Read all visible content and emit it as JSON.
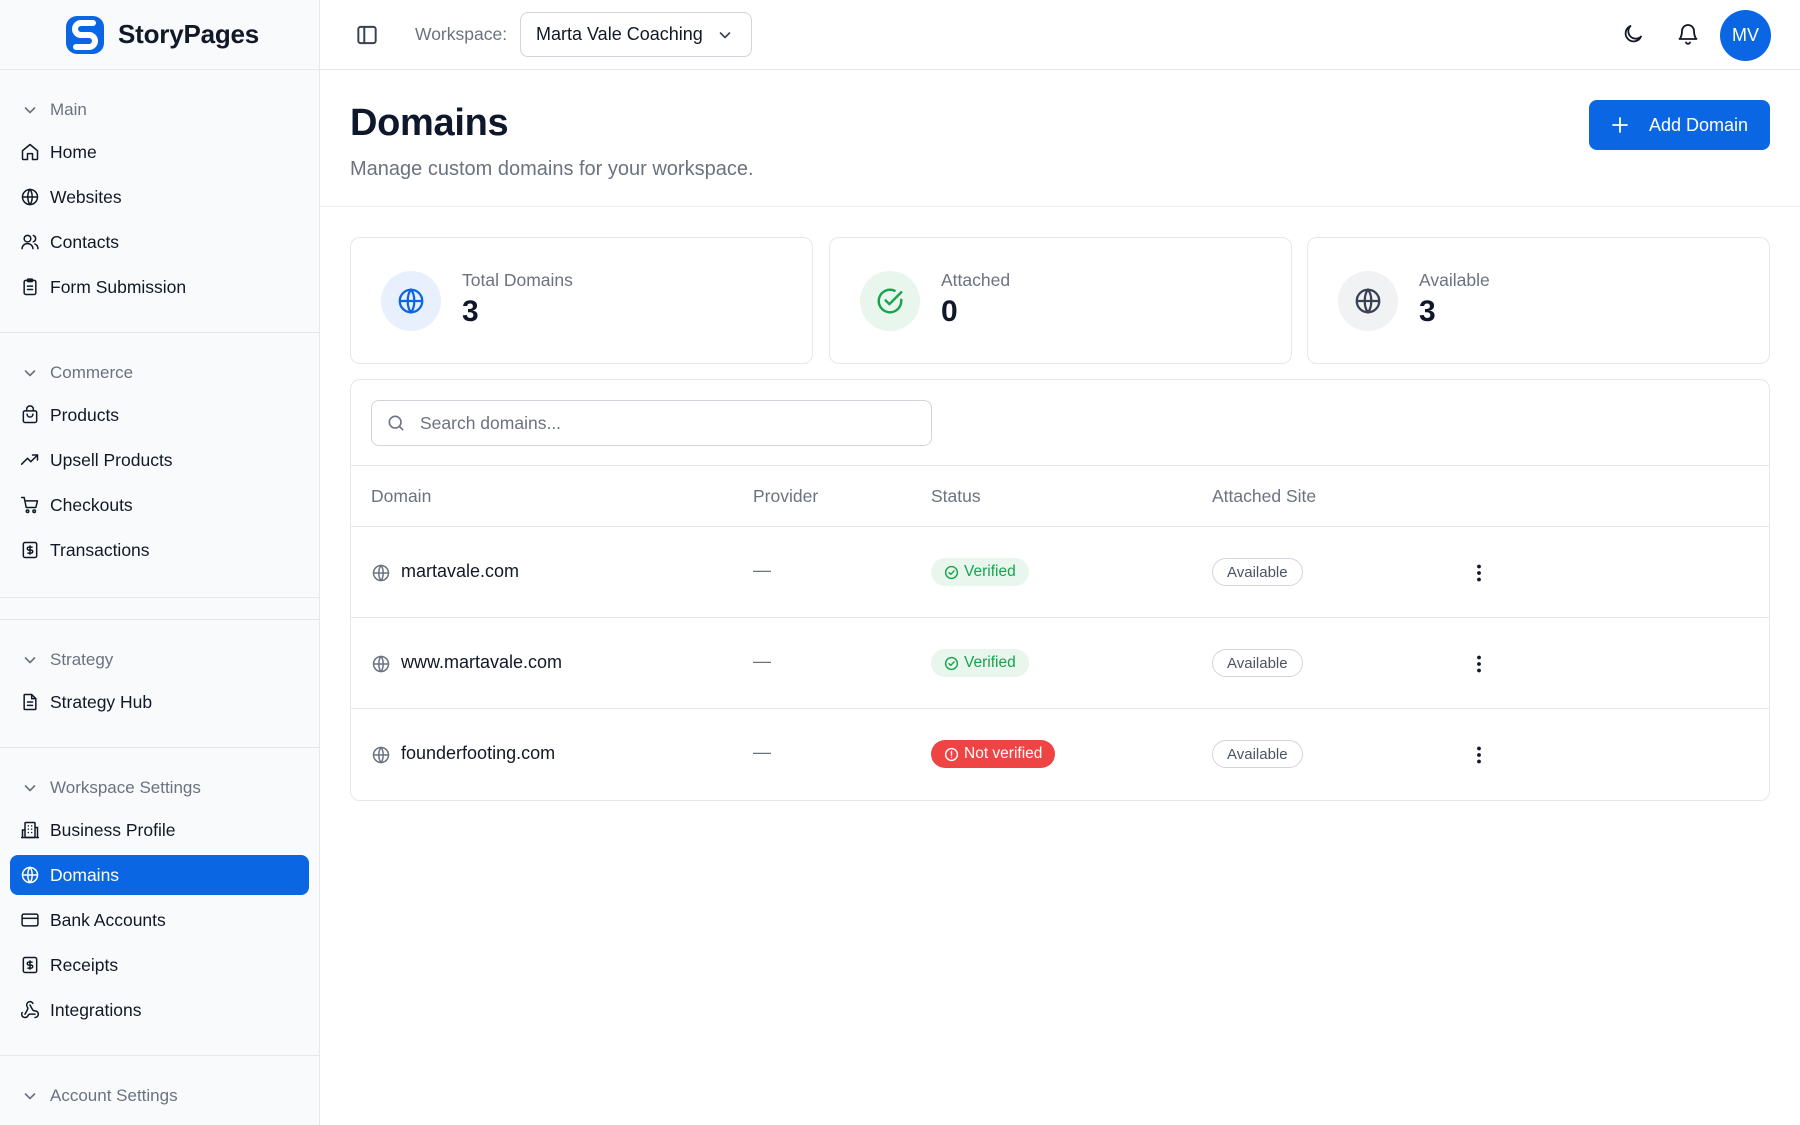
{
  "brand": {
    "name": "StoryPages",
    "color": "#0b66e4"
  },
  "sidebar": {
    "sections": [
      {
        "title": "Main",
        "items": [
          {
            "label": "Home",
            "icon": "home-icon"
          },
          {
            "label": "Websites",
            "icon": "globe-icon"
          },
          {
            "label": "Contacts",
            "icon": "users-icon"
          },
          {
            "label": "Form Submission",
            "icon": "clipboard-icon"
          }
        ]
      },
      {
        "title": "Commerce",
        "items": [
          {
            "label": "Products",
            "icon": "shopping-bag-icon"
          },
          {
            "label": "Upsell Products",
            "icon": "trending-up-icon"
          },
          {
            "label": "Checkouts",
            "icon": "cart-icon"
          },
          {
            "label": "Transactions",
            "icon": "dollar-receipt-icon"
          }
        ]
      },
      {
        "title": "Strategy",
        "items": [
          {
            "label": "Strategy Hub",
            "icon": "document-icon"
          }
        ]
      },
      {
        "title": "Workspace Settings",
        "items": [
          {
            "label": "Business Profile",
            "icon": "building-icon"
          },
          {
            "label": "Domains",
            "icon": "globe-icon",
            "active": true
          },
          {
            "label": "Bank Accounts",
            "icon": "credit-card-icon"
          },
          {
            "label": "Receipts",
            "icon": "dollar-receipt-icon"
          },
          {
            "label": "Integrations",
            "icon": "webhook-icon"
          }
        ]
      },
      {
        "title": "Account Settings",
        "items": []
      }
    ]
  },
  "topbar": {
    "workspace_label": "Workspace:",
    "workspace_value": "Marta Vale Coaching",
    "avatar_initials": "MV"
  },
  "page": {
    "title": "Domains",
    "subtitle": "Manage custom domains for your workspace.",
    "add_button": "Add Domain"
  },
  "stats": [
    {
      "label": "Total Domains",
      "value": "3",
      "icon": "globe-icon",
      "color": "#0b66e4",
      "bg": "#e8f0fd"
    },
    {
      "label": "Attached",
      "value": "0",
      "icon": "check-circle-icon",
      "color": "#16a34a",
      "bg": "#e8f6ee"
    },
    {
      "label": "Available",
      "value": "3",
      "icon": "globe-icon",
      "color": "#374151",
      "bg": "#f1f2f4"
    }
  ],
  "search": {
    "placeholder": "Search domains...",
    "value": ""
  },
  "table": {
    "columns": [
      "Domain",
      "Provider",
      "Status",
      "Attached Site"
    ],
    "rows": [
      {
        "domain": "martavale.com",
        "provider": "—",
        "status": "Verified",
        "status_type": "verified",
        "attached": "Available"
      },
      {
        "domain": "www.martavale.com",
        "provider": "—",
        "status": "Verified",
        "status_type": "verified",
        "attached": "Available"
      },
      {
        "domain": "founderfooting.com",
        "provider": "—",
        "status": "Not verified",
        "status_type": "not-verified",
        "attached": "Available"
      }
    ]
  },
  "colors": {
    "accent": "#0b66e4",
    "success": "#16a34a",
    "danger": "#ef4444"
  }
}
